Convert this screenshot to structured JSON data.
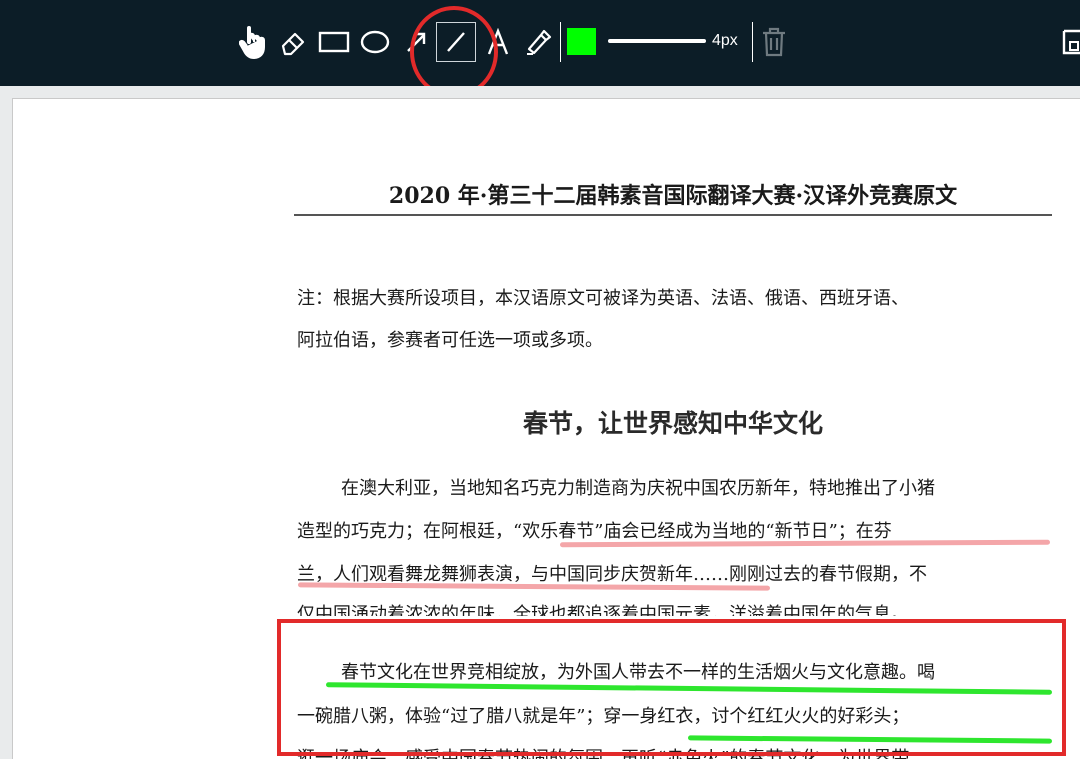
{
  "toolbar": {
    "tools": [
      {
        "name": "hand-tool"
      },
      {
        "name": "eraser-tool"
      },
      {
        "name": "rectangle-tool"
      },
      {
        "name": "ellipse-tool"
      },
      {
        "name": "arrow-tool"
      },
      {
        "name": "line-tool",
        "selected": true
      },
      {
        "name": "text-tool"
      },
      {
        "name": "highlighter-tool"
      }
    ],
    "color": "#00ff00",
    "stroke_width_label": "4px",
    "icons": [
      "hand-icon",
      "eraser-icon",
      "rectangle-icon",
      "ellipse-icon",
      "arrow-icon",
      "line-icon",
      "text-icon",
      "pen-icon",
      "trash-icon",
      "save-icon"
    ]
  },
  "document": {
    "title": "2020 年·第三十二届韩素音国际翻译大赛·汉译外竞赛原文",
    "note_lines": [
      "注：根据大赛所设项目，本汉语原文可被译为英语、法语、俄语、西班牙语、",
      "阿拉伯语，参赛者可任选一项或多项。"
    ],
    "heading": "春节，让世界感知中华文化",
    "para1_lines": [
      "在澳大利亚，当地知名巧克力制造商为庆祝中国农历新年，特地推出了小猪",
      "造型的巧克力；在阿根廷，“欢乐春节”庙会已经成为当地的“新节日”；在芬",
      "兰，人们观看舞龙舞狮表演，与中国同步庆贺新年……刚刚过去的春节假期，不",
      "仅中国涌动着浓浓的年味，全球也都追逐着中国元素，洋溢着中国年的气息。"
    ],
    "para2_lines": [
      "春节文化在世界竞相绽放，为外国人带去不一样的生活烟火与文化意趣。喝",
      "一碗腊八粥，体验“过了腊八就是年”；穿一身红衣，讨个红红火火的好彩头；",
      "逛一场庙会，感受中国春节热闹的氛围；再听“赤兔火”的春节文化，为世界带"
    ]
  },
  "annotation_colors": {
    "red": "#e22a2a",
    "pink": "#f4a6a9",
    "green": "#2ee62e"
  }
}
